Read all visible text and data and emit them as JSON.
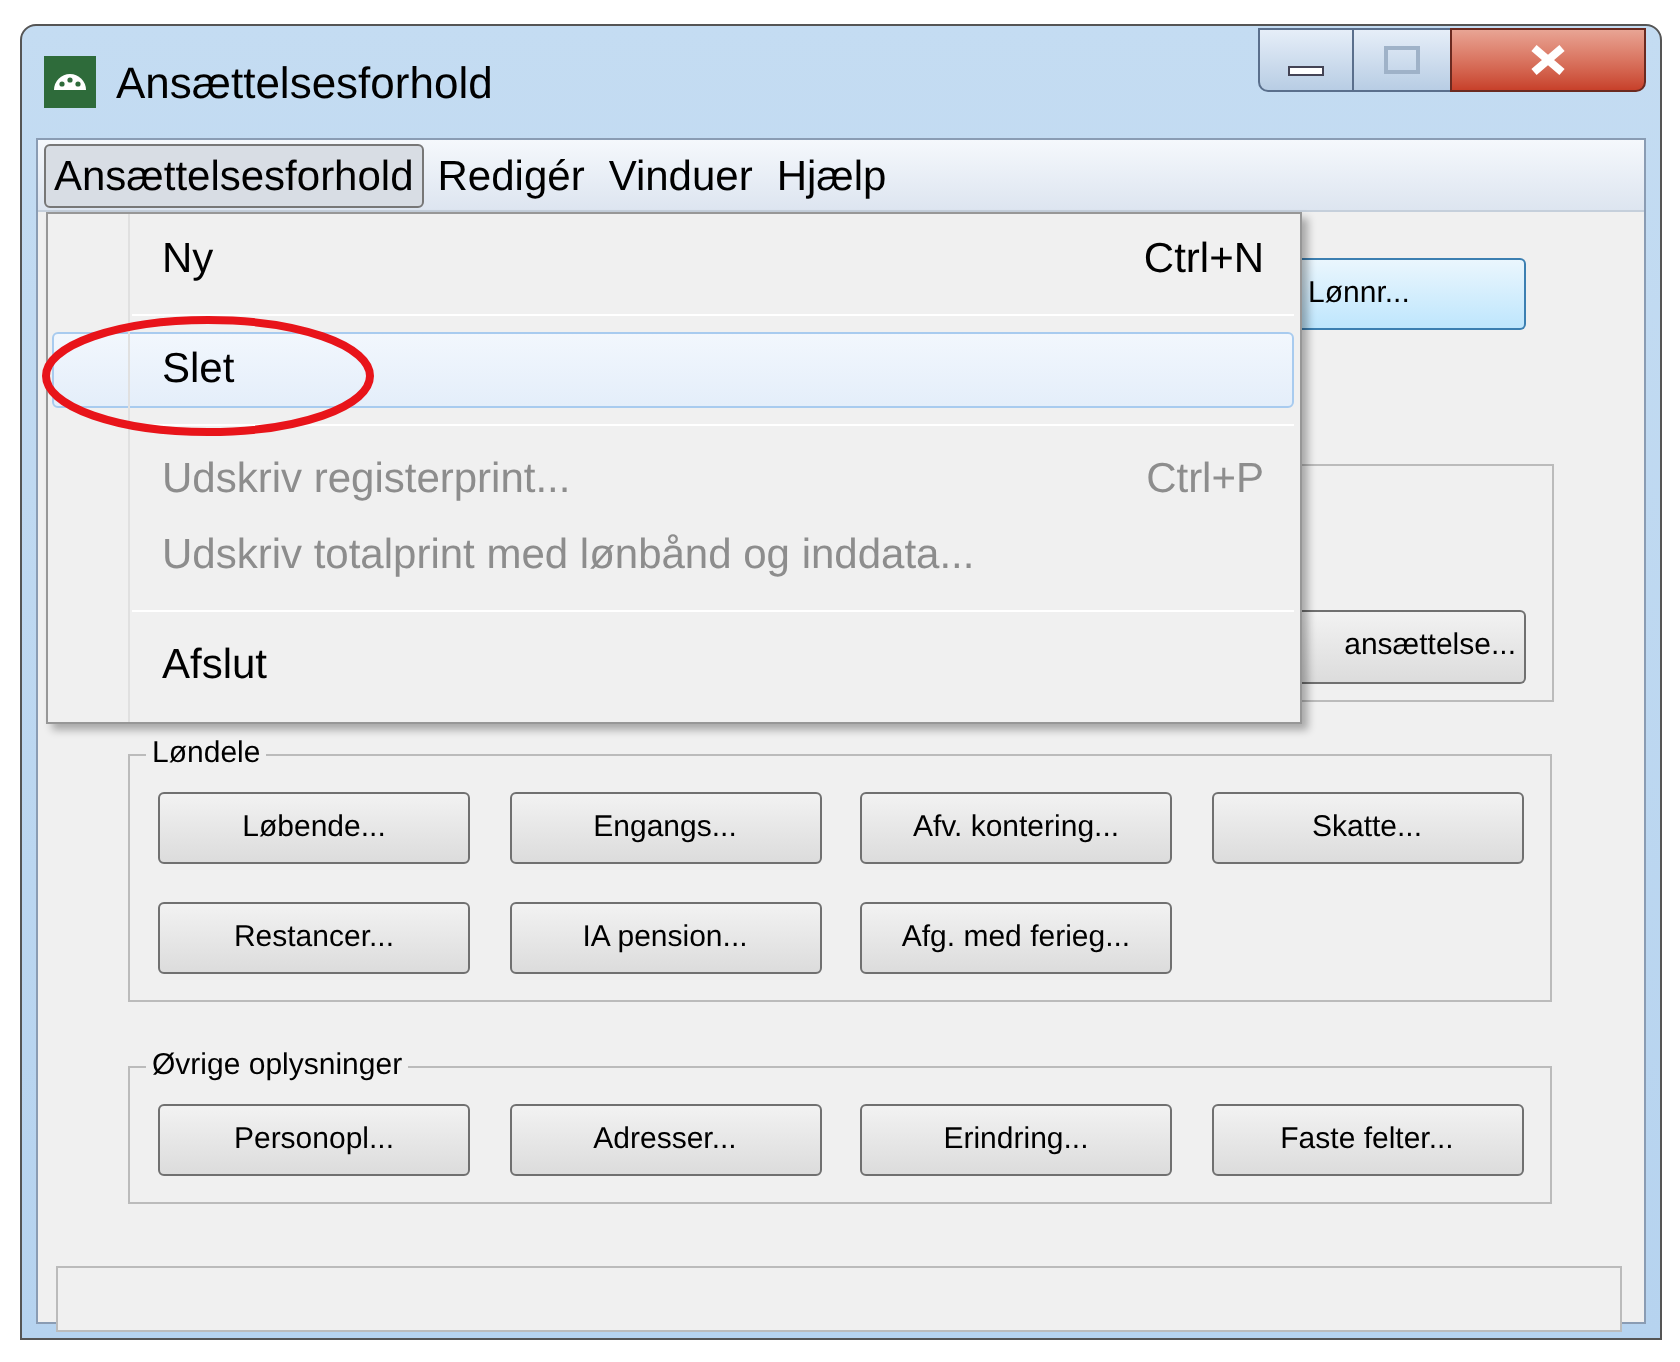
{
  "window": {
    "title": "Ansættelsesforhold"
  },
  "menu_bar": [
    {
      "label": "Ansættelsesforhold",
      "selected": true
    },
    {
      "label": "Redigér",
      "selected": false
    },
    {
      "label": "Vinduer",
      "selected": false
    },
    {
      "label": "Hjælp",
      "selected": false
    }
  ],
  "dropdown": [
    {
      "kind": "item",
      "label": "Ny",
      "shortcut": "Ctrl+N",
      "disabled": false,
      "highlighted": false
    },
    {
      "kind": "separator"
    },
    {
      "kind": "item",
      "label": "Slet",
      "disabled": false,
      "highlighted": true
    },
    {
      "kind": "separator"
    },
    {
      "kind": "item",
      "label": "Udskriv registerprint...",
      "shortcut": "Ctrl+P",
      "disabled": true,
      "highlighted": false
    },
    {
      "kind": "item",
      "label": "Udskriv totalprint med lønbånd og inddata...",
      "disabled": true,
      "highlighted": false
    },
    {
      "kind": "separator"
    },
    {
      "kind": "item",
      "label": "Afslut",
      "disabled": false,
      "highlighted": false
    }
  ],
  "partly_hidden_buttons": [
    {
      "label": "Lønnr...",
      "hovered": true
    },
    {
      "label": "ansættelse...",
      "hovered": false
    }
  ],
  "groups": [
    {
      "title": "Løndele",
      "buttons": [
        "Løbende...",
        "Engangs...",
        "Afv. kontering...",
        "Skatte...",
        "Restancer...",
        "IA pension...",
        "Afg. med ferieg..."
      ]
    },
    {
      "title": "Øvrige oplysninger",
      "buttons": [
        "Personopl...",
        "Adresser...",
        "Erindring...",
        "Faste felter..."
      ]
    }
  ]
}
